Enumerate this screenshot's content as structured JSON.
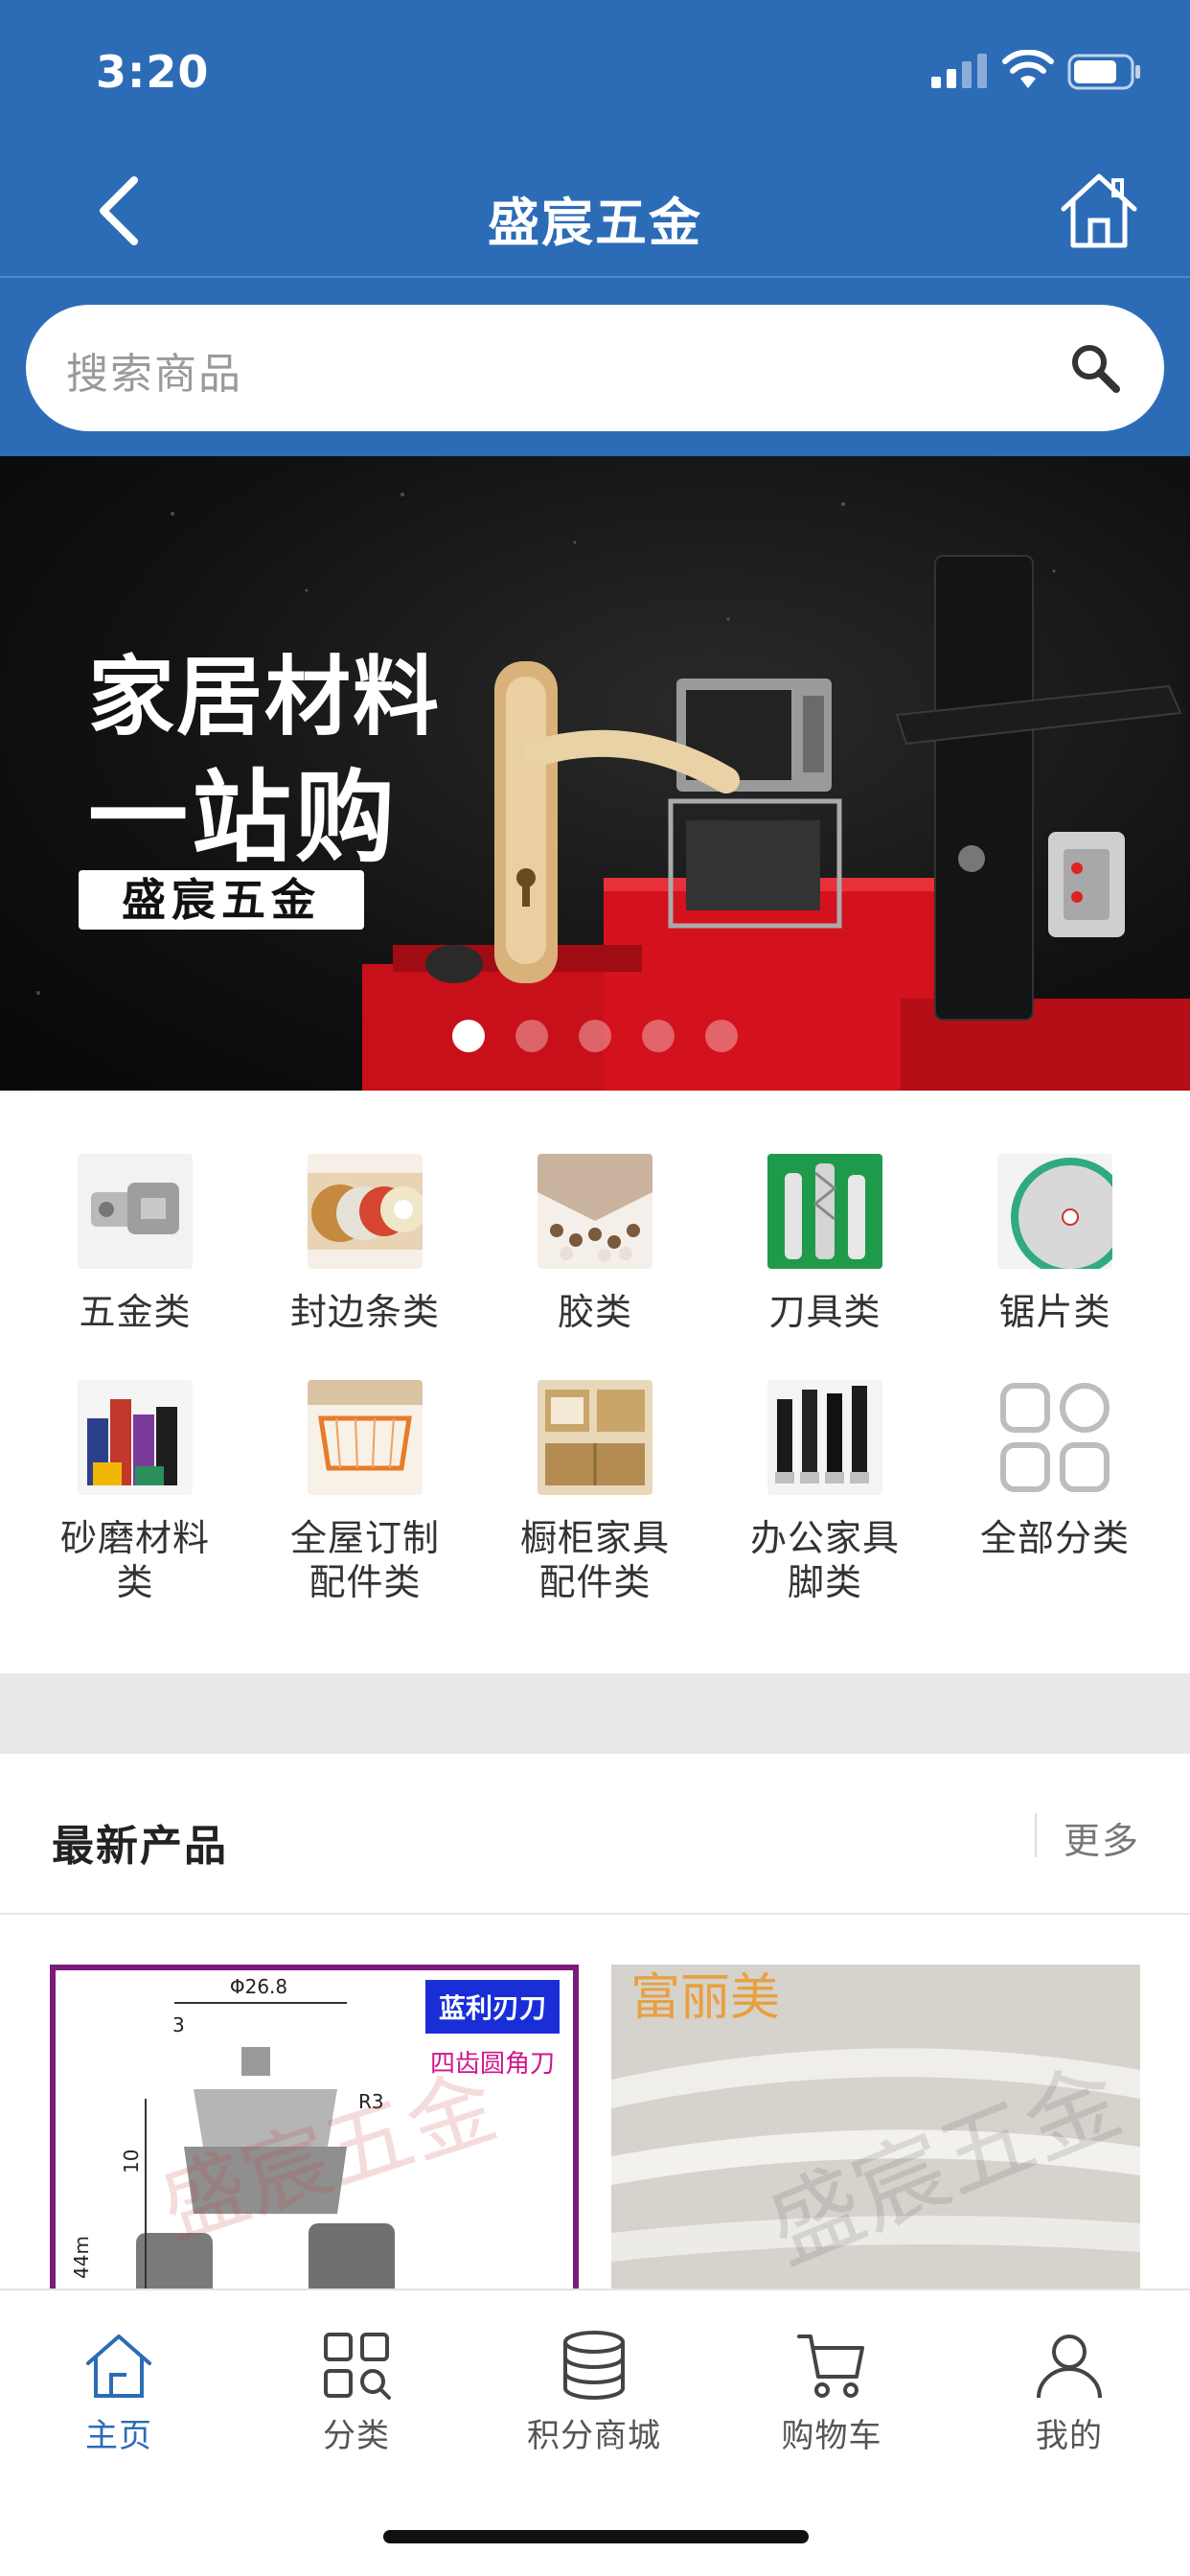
{
  "status": {
    "time": "3:20"
  },
  "nav": {
    "title": "盛宸五金"
  },
  "search": {
    "placeholder": "搜索商品"
  },
  "banner": {
    "line1": "家居材料",
    "line2": "一站购",
    "tag": "盛宸五金",
    "dots_total": 5,
    "active_dot": 1
  },
  "categories": [
    {
      "label": "五金类",
      "icon": "hinge-thumbnail"
    },
    {
      "label": "封边条类",
      "icon": "edge-band-thumbnail"
    },
    {
      "label": "胶类",
      "icon": "glue-thumbnail"
    },
    {
      "label": "刀具类",
      "icon": "cutter-thumbnail"
    },
    {
      "label": "锯片类",
      "icon": "saw-blade-thumbnail"
    },
    {
      "label": "砂磨材料类",
      "icon": "abrasive-thumbnail"
    },
    {
      "label": "全屋订制配件类",
      "icon": "basket-thumbnail"
    },
    {
      "label": "橱柜家具配件类",
      "icon": "cabinet-thumbnail"
    },
    {
      "label": "办公家具脚类",
      "icon": "furniture-leg-thumbnail"
    },
    {
      "label": "全部分类",
      "icon": "grid-icon"
    }
  ],
  "latest": {
    "title": "最新产品",
    "more": "更多"
  },
  "products": [
    {
      "name_tag": "蓝利刃刀",
      "sub_tag": "四齿圆角刀",
      "dim": "Φ26.8",
      "r": "R3",
      "a": "3",
      "b": "10",
      "c": "44m",
      "watermark": "盛宸五金"
    },
    {
      "brand": "富丽美",
      "watermark": "盛宸五金"
    }
  ],
  "tabs": [
    {
      "label": "主页",
      "icon": "home-icon",
      "active": true
    },
    {
      "label": "分类",
      "icon": "category-icon",
      "active": false
    },
    {
      "label": "积分商城",
      "icon": "coins-icon",
      "active": false
    },
    {
      "label": "购物车",
      "icon": "cart-icon",
      "active": false
    },
    {
      "label": "我的",
      "icon": "user-icon",
      "active": false
    }
  ],
  "colors": {
    "brand": "#2c6cb7",
    "gap": "#e8e8e8"
  }
}
